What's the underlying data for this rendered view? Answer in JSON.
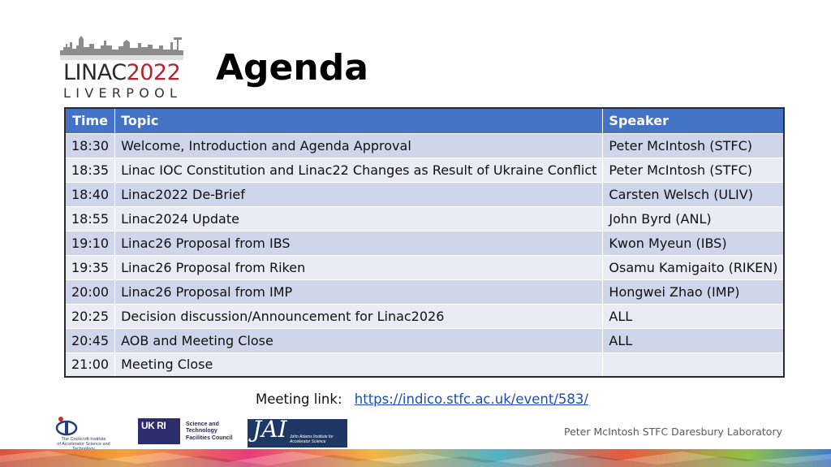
{
  "logo": {
    "main_prefix": "LINAC",
    "main_year": "2022",
    "sub": "LIVERPOOL"
  },
  "title": "Agenda",
  "table": {
    "headers": [
      "Time",
      "Topic",
      "Speaker"
    ],
    "rows": [
      {
        "time": "18:30",
        "topic": "Welcome, Introduction and Agenda Approval",
        "speaker": "Peter McIntosh (STFC)"
      },
      {
        "time": "18:35",
        "topic": "Linac IOC Constitution and Linac22 Changes as Result of Ukraine Conflict",
        "speaker": "Peter McIntosh (STFC)"
      },
      {
        "time": "18:40",
        "topic": "Linac2022 De-Brief",
        "speaker": "Carsten Welsch (ULIV)"
      },
      {
        "time": "18:55",
        "topic": "Linac2024 Update",
        "speaker": "John Byrd (ANL)"
      },
      {
        "time": "19:10",
        "topic": "Linac26 Proposal from IBS",
        "speaker": "Kwon Myeun (IBS)"
      },
      {
        "time": "19:35",
        "topic": "Linac26 Proposal from Riken",
        "speaker": "Osamu Kamigaito (RIKEN)"
      },
      {
        "time": "20:00",
        "topic": "Linac26 Proposal from IMP",
        "speaker": "Hongwei Zhao (IMP)"
      },
      {
        "time": "20:25",
        "topic": "Decision discussion/Announcement for Linac2026",
        "speaker": "ALL"
      },
      {
        "time": "20:45",
        "topic": "AOB and Meeting Close",
        "speaker": "ALL"
      },
      {
        "time": "21:00",
        "topic": "Meeting Close",
        "speaker": ""
      }
    ]
  },
  "meeting": {
    "label": "Meeting link:",
    "url": "https://indico.stfc.ac.uk/event/583/"
  },
  "footer": {
    "credit": "Peter McIntosh STFC Daresbury Laboratory",
    "ci_name": "The Cockcroft Institute",
    "ci_tagline": "of Accelerator Science and Technology",
    "ukri_mark": "UK RI",
    "stfc_name": "Science and Technology Facilities Council",
    "jai_mark": "JAI",
    "jai_name": "John Adams Institute for Accelerator Science"
  },
  "colors": {
    "header_blue": "#4472c4",
    "row_odd": "#cfd5ea",
    "row_even": "#e9ebf5",
    "logo_red": "#b5232a",
    "link_blue": "#1a4db8"
  }
}
